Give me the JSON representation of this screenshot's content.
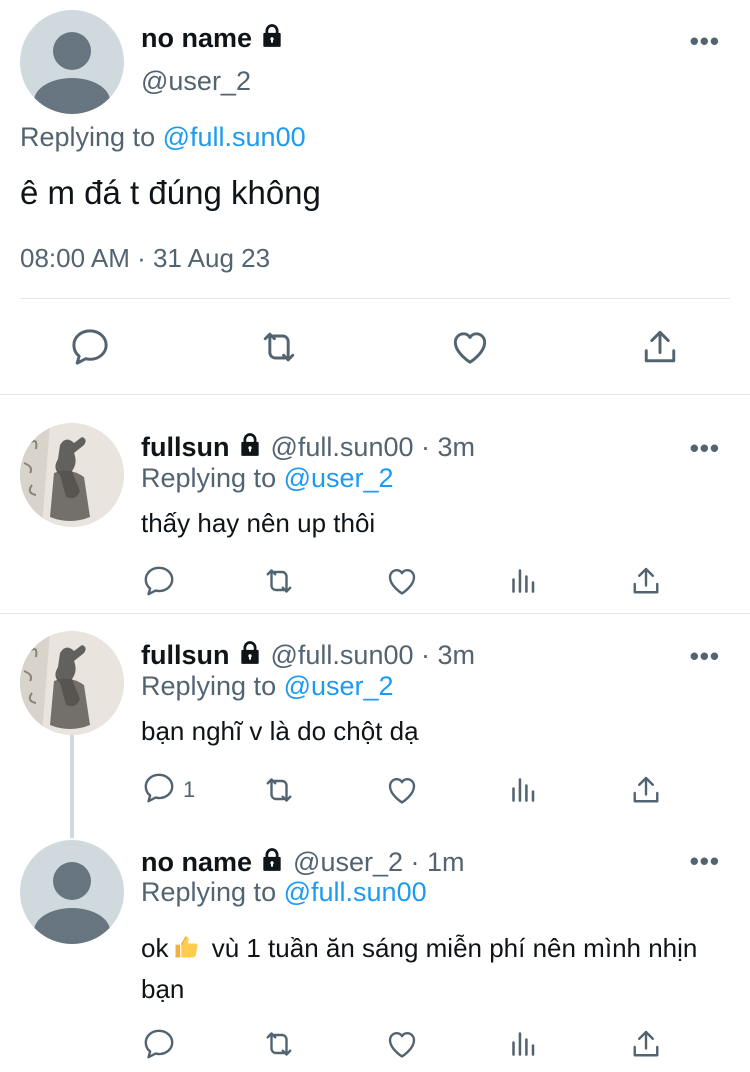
{
  "main_tweet": {
    "name": "no name",
    "handle": "@user_2",
    "replying_prefix": "Replying to",
    "replying_to": "@full.sun00",
    "text": "ê m đá t đúng không",
    "timestamp": "08:00 AM · 31 Aug 23",
    "icons": [
      "reply-icon",
      "retweet-icon",
      "like-icon",
      "share-icon"
    ]
  },
  "replies": [
    {
      "name": "fullsun",
      "meta": "@full.sun00 · 3m",
      "replying_prefix": "Replying to",
      "replying_to": "@user_2",
      "text": "thấy hay nên up thôi",
      "reply_count": ""
    },
    {
      "name": "fullsun",
      "meta": "@full.sun00 · 3m",
      "replying_prefix": "Replying to",
      "replying_to": "@user_2",
      "text": "bạn nghĩ v là do chột dạ",
      "reply_count": "1"
    },
    {
      "name": "no name",
      "meta": "@user_2 · 1m",
      "replying_prefix": "Replying to",
      "replying_to": "@full.sun00",
      "text_before_emoji": "ok",
      "text_after_emoji": " vù 1 tuần ăn sáng miễn phí nên mình nhịn bạn",
      "reply_count": ""
    }
  ],
  "more_label": "•••",
  "colors": {
    "link": "#1d9bf0",
    "muted": "#536471",
    "divider": "#e1e8ed",
    "avatar_bg": "#cfd9de",
    "avatar_fg": "#66757f"
  }
}
